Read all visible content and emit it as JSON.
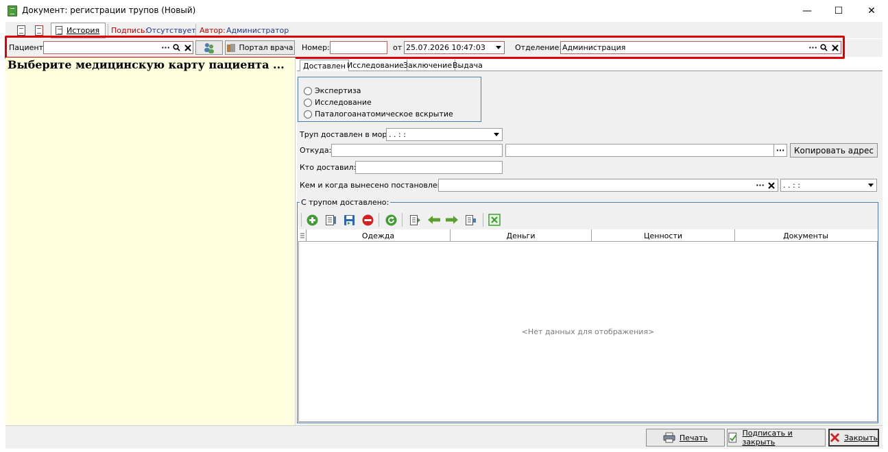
{
  "window": {
    "title": "Документ: регистрации трупов (Новый)",
    "minimize_glyph": "—",
    "maximize_glyph": "☐",
    "close_glyph": "✕"
  },
  "toolbar": {
    "history_label": "История",
    "signature_label": "Подпись:",
    "signature_value": "Отсутствует",
    "author_label": "Автор:",
    "author_value": "Администратор"
  },
  "patient_bar": {
    "patient_label": "Пациент:",
    "patient_value": "",
    "ellipsis": "···",
    "portal_label": "Портал врача",
    "number_label": "Номер:",
    "number_value": "",
    "from_label": "от",
    "date_value": "25.07.2026 10:47:03",
    "department_label": "Отделение:",
    "department_value": "Администрация"
  },
  "left_pane": {
    "caption": "Выберите медицинскую карту пациента ..."
  },
  "tabs": [
    {
      "label": "Доставлен"
    },
    {
      "label": "Исследование"
    },
    {
      "label": "Заключение"
    },
    {
      "label": "Выдача"
    }
  ],
  "radios": [
    {
      "label": "Экспертиза"
    },
    {
      "label": "Исследование"
    },
    {
      "label": "Паталогоанатомическое вскрытие"
    }
  ],
  "form": {
    "delivered_label": "Труп доставлен в морг:",
    "delivered_value": " .  .      :  :",
    "from_where_label": "Откуда:",
    "from_where_value": "",
    "address_value": "",
    "copy_address_label": "Копировать адрес",
    "who_delivered_label": "Кто доставил:",
    "who_delivered_value": "",
    "ruling_label": "Кем и когда вынесено постановление:",
    "ruling_value": "",
    "ruling_date_value": " .  .      :  :"
  },
  "grid": {
    "group_title": "С трупом доставлено:",
    "columns": [
      "Одежда",
      "Деньги",
      "Ценности",
      "Документы"
    ],
    "empty_text": "<Нет данных для отображения>"
  },
  "footer": {
    "print_label": "Печать",
    "sign_close_label": "Подписать и закрыть",
    "close_label": "Закрыть"
  },
  "colors": {
    "highlight_frame": "#e00000",
    "left_pane_bg": "#ffffe0",
    "link_red": "#c00000",
    "link_blue": "#1d3a8a"
  }
}
